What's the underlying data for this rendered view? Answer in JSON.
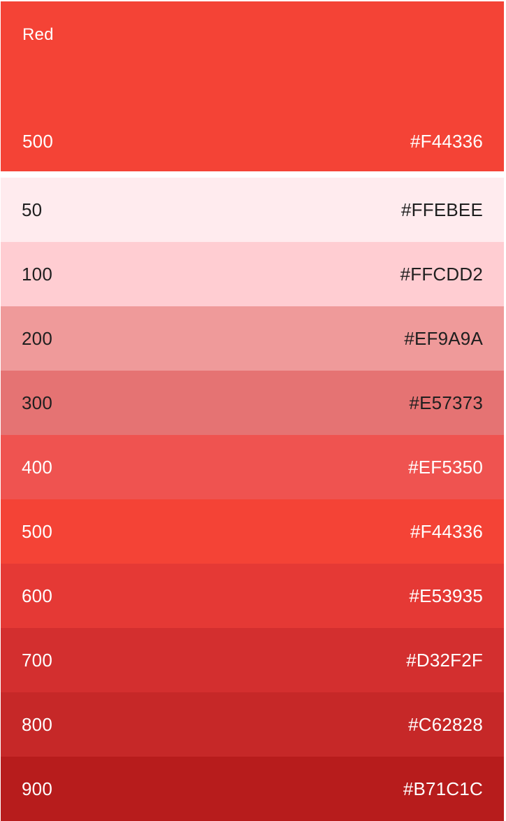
{
  "palette": {
    "title": "Red",
    "primary": {
      "shade": "500",
      "hex": "#F44336",
      "color": "#F44336",
      "text_color": "#FFFFFF"
    },
    "swatches": [
      {
        "shade": "50",
        "hex": "#FFEBEE",
        "color": "#FFEBEE",
        "text_color": "#1F1F1F"
      },
      {
        "shade": "100",
        "hex": "#FFCDD2",
        "color": "#FFCDD2",
        "text_color": "#1F1F1F"
      },
      {
        "shade": "200",
        "hex": "#EF9A9A",
        "color": "#EF9A9A",
        "text_color": "#1F1F1F"
      },
      {
        "shade": "300",
        "hex": "#E57373",
        "color": "#E57373",
        "text_color": "#1F1F1F"
      },
      {
        "shade": "400",
        "hex": "#EF5350",
        "color": "#EF5350",
        "text_color": "#FFFFFF"
      },
      {
        "shade": "500",
        "hex": "#F44336",
        "color": "#F44336",
        "text_color": "#FFFFFF"
      },
      {
        "shade": "600",
        "hex": "#E53935",
        "color": "#E53935",
        "text_color": "#FFFFFF"
      },
      {
        "shade": "700",
        "hex": "#D32F2F",
        "color": "#D32F2F",
        "text_color": "#FFFFFF"
      },
      {
        "shade": "800",
        "hex": "#C62828",
        "color": "#C62828",
        "text_color": "#FFFFFF"
      },
      {
        "shade": "900",
        "hex": "#B71C1C",
        "color": "#B71C1C",
        "text_color": "#FFFFFF"
      }
    ]
  }
}
